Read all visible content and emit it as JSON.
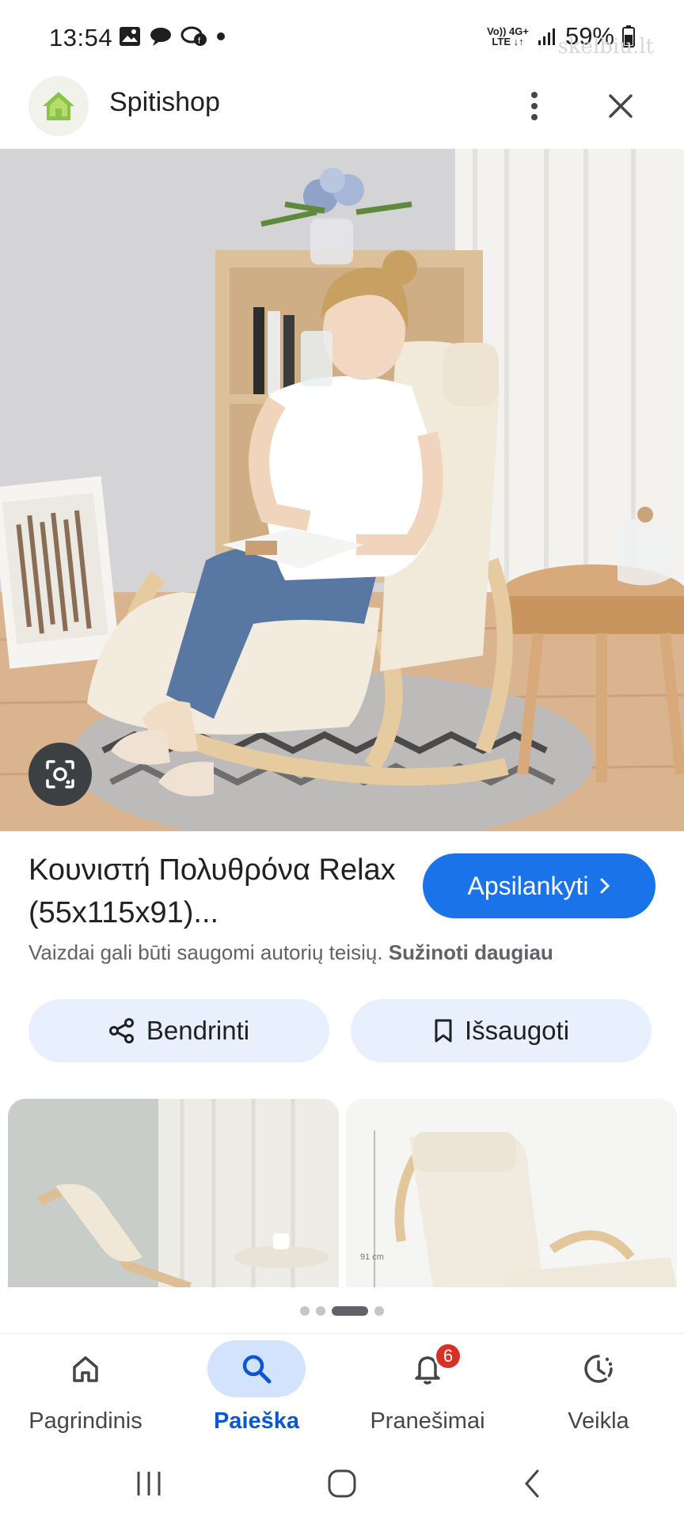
{
  "status_bar": {
    "time": "13:54",
    "network_top": "Vo)) 4G+",
    "network_bottom": "LTE ↓↑",
    "battery": "59%",
    "watermark": "skelbiu.lt"
  },
  "header": {
    "site_name": "Spitishop"
  },
  "result": {
    "title": "Κουνιστή Πολυθρόνα Relax (55x115x91)...",
    "visit_label": "Apsilankyti",
    "copyright_text": "Vaizdai gali būti saugomi autorių teisių.",
    "learn_more": "Sužinoti daugiau"
  },
  "actions": {
    "share_label": "Bendrinti",
    "save_label": "Išsaugoti"
  },
  "thumbnail_caption": "91 cm",
  "carousel": {
    "total": 4,
    "active_index": 2
  },
  "bottom_nav": {
    "items": [
      {
        "label": "Pagrindinis",
        "icon": "home-icon"
      },
      {
        "label": "Paieška",
        "icon": "search-icon"
      },
      {
        "label": "Pranešimai",
        "icon": "bell-icon"
      },
      {
        "label": "Veikla",
        "icon": "activity-icon"
      }
    ],
    "active_index": 1,
    "notifications_badge": "6"
  },
  "colors": {
    "accent": "#1a73e8",
    "chip_bg": "#e8f0fe",
    "active_nav_bg": "#d3e3fd",
    "badge": "#d93025",
    "logo_green": "#8bc34a"
  }
}
